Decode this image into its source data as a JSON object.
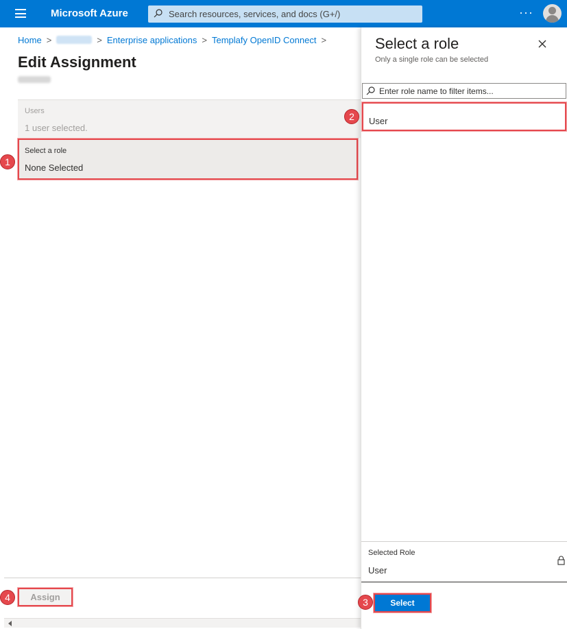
{
  "topbar": {
    "brand": "Microsoft Azure",
    "search_placeholder": "Search resources, services, and docs (G+/)",
    "more": "···"
  },
  "breadcrumb": {
    "items": [
      "Home",
      "",
      "Enterprise applications",
      "Templafy OpenID Connect"
    ],
    "separator": ">"
  },
  "page": {
    "title": "Edit Assignment"
  },
  "users": {
    "label": "Users",
    "value": "1 user selected."
  },
  "role": {
    "label": "Select a role",
    "value": "None Selected"
  },
  "footer": {
    "assign_label": "Assign"
  },
  "panel": {
    "title": "Select a role",
    "subtitle": "Only a single role can be selected",
    "filter_placeholder": "Enter role name to filter items...",
    "roles": [
      "User"
    ],
    "selected_label": "Selected Role",
    "selected_value": "User",
    "select_label": "Select"
  },
  "badges": [
    "1",
    "2",
    "3",
    "4"
  ],
  "colors": {
    "accent": "#0078d4",
    "highlight": "#e5484d"
  }
}
